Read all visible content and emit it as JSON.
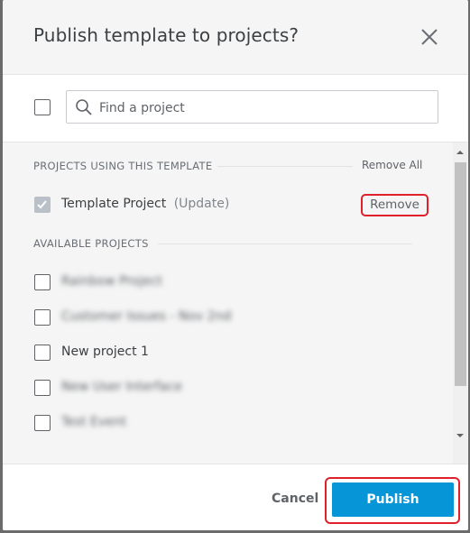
{
  "dialog": {
    "title": "Publish template to projects?"
  },
  "search": {
    "placeholder": "Find a project",
    "value": ""
  },
  "using_section": {
    "label": "PROJECTS USING THIS TEMPLATE",
    "remove_all_label": "Remove All",
    "items": [
      {
        "name": "Template Project",
        "status": "(Update)",
        "checked": true,
        "remove_label": "Remove"
      }
    ]
  },
  "available_section": {
    "label": "AVAILABLE PROJECTS",
    "items": [
      {
        "name": "Rainbow Project",
        "blurred": true,
        "checked": false
      },
      {
        "name": "Customer Issues - Nov 2nd",
        "blurred": true,
        "checked": false
      },
      {
        "name": "New project 1",
        "blurred": false,
        "checked": false
      },
      {
        "name": "New User Interface",
        "blurred": true,
        "checked": false
      },
      {
        "name": "Test Event",
        "blurred": true,
        "checked": false
      }
    ]
  },
  "footer": {
    "cancel_label": "Cancel",
    "publish_label": "Publish"
  },
  "colors": {
    "accent": "#0696d7",
    "highlight": "#e0202b"
  },
  "icons": [
    "close-icon",
    "search-icon",
    "check-icon",
    "scroll-up-icon",
    "scroll-down-icon"
  ]
}
